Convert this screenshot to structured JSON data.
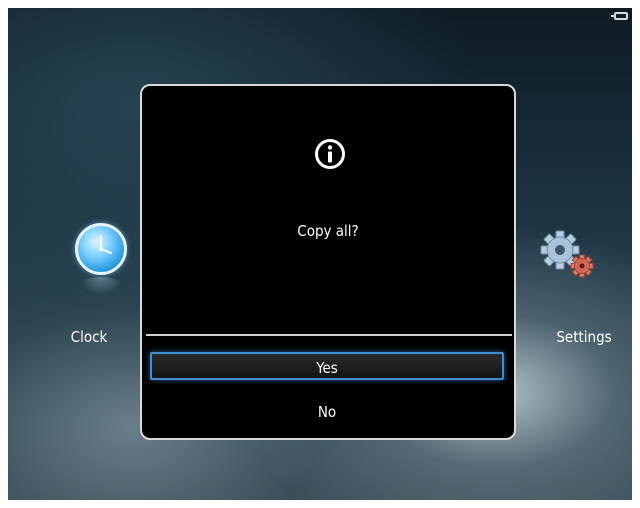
{
  "status": {
    "battery_icon": "battery-icon"
  },
  "side_items": {
    "clock": {
      "label": "Clock",
      "icon": "clock-icon"
    },
    "settings": {
      "label": "Settings",
      "icon": "settings-gears-icon"
    }
  },
  "dialog": {
    "icon": "info-icon",
    "message": "Copy  all?",
    "options": [
      {
        "label": "Yes",
        "selected": true
      },
      {
        "label": "No",
        "selected": false
      }
    ]
  },
  "colors": {
    "dialog_background": "#000000",
    "dialog_border": "#d9d9d9",
    "selection_border": "#3d8ed2",
    "text": "#ffffff"
  }
}
